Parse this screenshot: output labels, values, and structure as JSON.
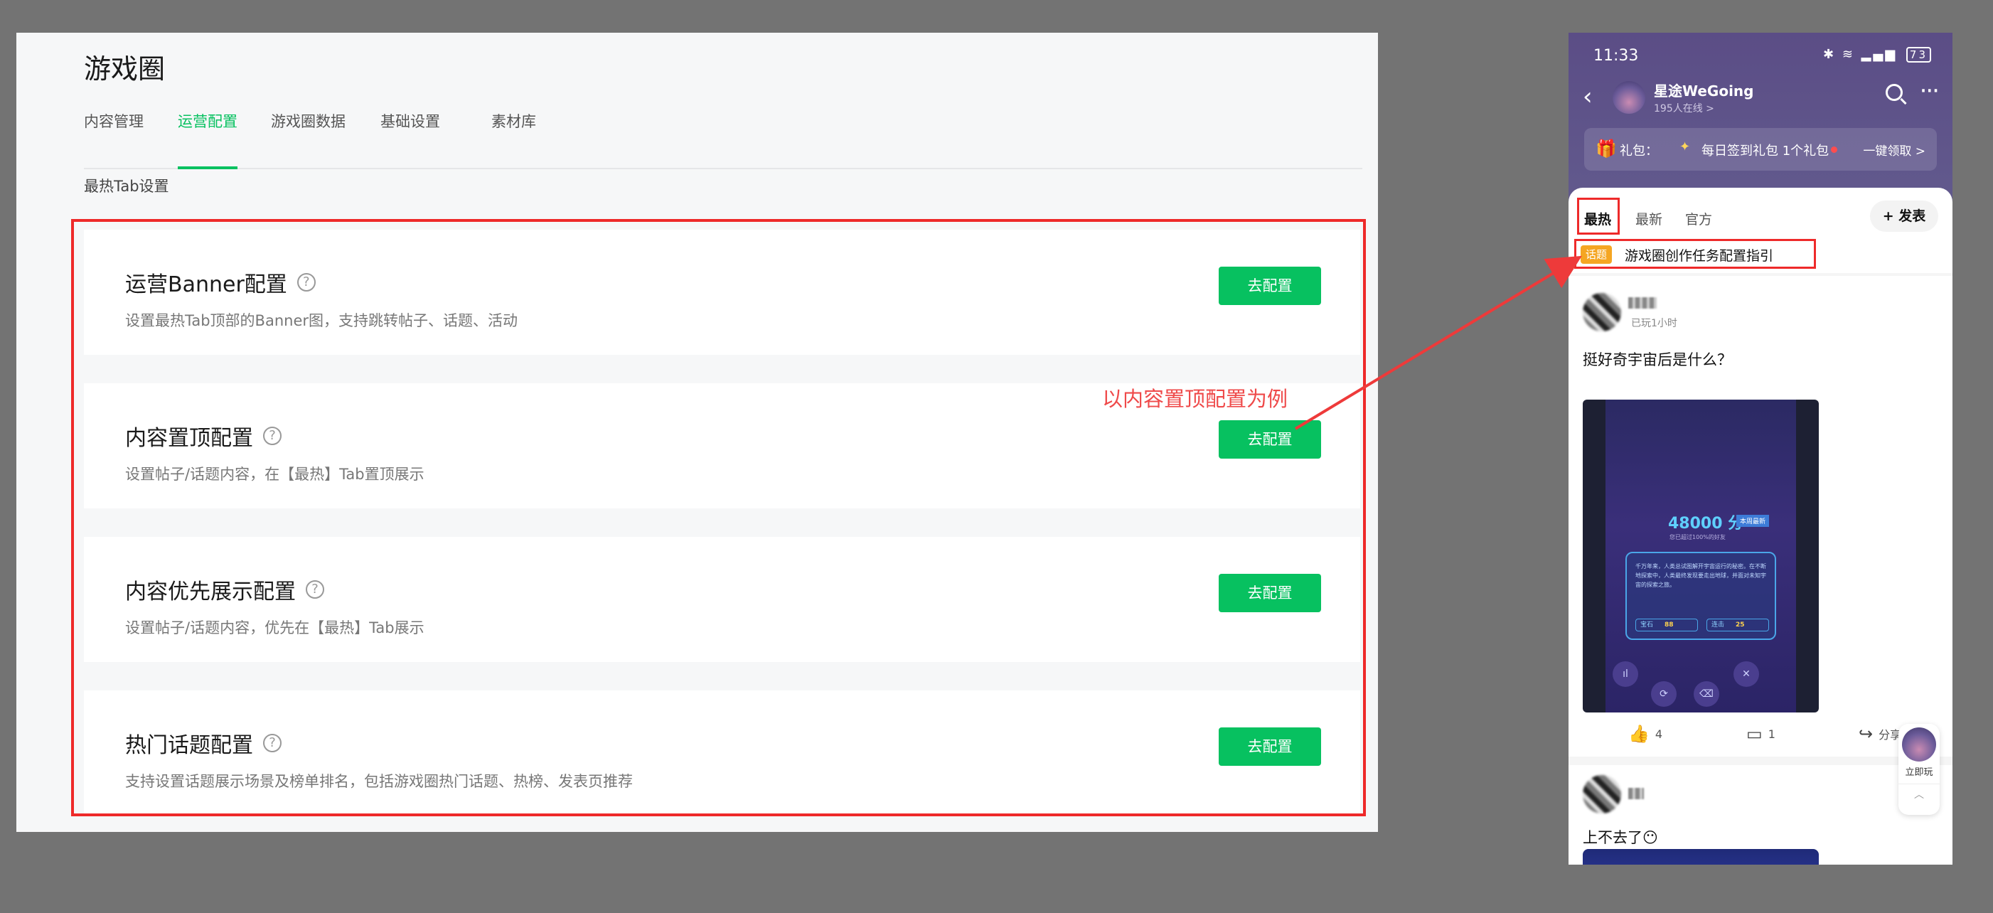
{
  "admin": {
    "title": "游戏圈",
    "tabs": [
      {
        "label": "内容管理"
      },
      {
        "label": "运营配置"
      },
      {
        "label": "游戏圈数据"
      },
      {
        "label": "基础设置"
      },
      {
        "label": "素材库"
      }
    ],
    "section_title": "最热Tab设置",
    "cards": [
      {
        "title": "运营Banner配置",
        "desc": "设置最热Tab顶部的Banner图，支持跳转帖子、话题、活动",
        "button": "去配置"
      },
      {
        "title": "内容置顶配置",
        "desc": "设置帖子/话题内容，在【最热】Tab置顶展示",
        "button": "去配置"
      },
      {
        "title": "内容优先展示配置",
        "desc": "设置帖子/话题内容，优先在【最热】Tab展示",
        "button": "去配置"
      },
      {
        "title": "热门话题配置",
        "desc": "支持设置话题展示场景及榜单排名，包括游戏圈热门话题、热榜、发表页推荐",
        "button": "去配置"
      }
    ],
    "help_glyph": "?"
  },
  "annotation": {
    "label": "以内容置顶配置为例",
    "color": "#ef4a4a"
  },
  "phone": {
    "status": {
      "time": "11:33",
      "battery": "73"
    },
    "circle": {
      "name": "星途WeGoing",
      "online": "195人在线 >"
    },
    "gift": {
      "label": "礼包：",
      "text": "每日签到礼包 1个礼包",
      "claim": "一键领取 >"
    },
    "tabs": [
      {
        "label": "最热"
      },
      {
        "label": "最新"
      },
      {
        "label": "官方"
      }
    ],
    "post_button": "+ 发表",
    "topic": {
      "tag": "话题",
      "text": "游戏圈创作任务配置指引"
    },
    "posts": [
      {
        "meta": "已玩1小时",
        "text": "挺好奇宇宙后是什么？",
        "game": {
          "score": "48000 分",
          "score_tag": "本周最新",
          "sub": "您已超过100%的好友",
          "story": "千万年来，人类总试图解开宇宙运行的秘密。在不断地探索中，人类最终发现要走出地球，并面对未知宇宙的探索之旅。",
          "stats": [
            {
              "label": "宝石",
              "value": "88"
            },
            {
              "label": "连击",
              "value": "25"
            }
          ]
        },
        "likes": "4",
        "comments": "1",
        "share": "分享"
      },
      {
        "text": "上不去了😶"
      }
    ],
    "play_label": "立即玩"
  },
  "colors": {
    "accent_green": "#07c160",
    "highlight_red": "#ee2a2a",
    "phone_header": "#5b4d86"
  }
}
